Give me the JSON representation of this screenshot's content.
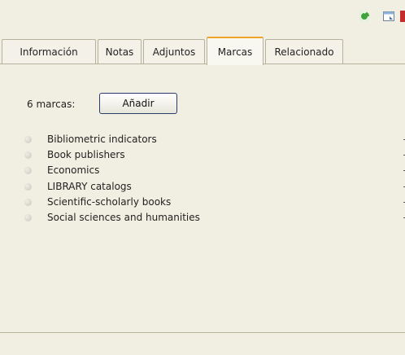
{
  "toolbar": {
    "icons": [
      "refresh-icon",
      "window-icon",
      "close-icon"
    ]
  },
  "tabs": [
    {
      "label": "Información"
    },
    {
      "label": "Notas"
    },
    {
      "label": "Adjuntos"
    },
    {
      "label": "Marcas",
      "active": true
    },
    {
      "label": "Relacionado"
    }
  ],
  "tags": {
    "count_label": "6 marcas:",
    "add_label": "Añadir",
    "items": [
      {
        "label": "Bibliometric indicators"
      },
      {
        "label": "Book publishers"
      },
      {
        "label": "Economics"
      },
      {
        "label": "LIBRARY catalogs"
      },
      {
        "label": "Scientific-scholarly books"
      },
      {
        "label": "Social sciences and humanities"
      }
    ],
    "remove_label": "-"
  },
  "colors": {
    "background": "#f1efe2",
    "active_tab_accent": "#f0a328"
  }
}
